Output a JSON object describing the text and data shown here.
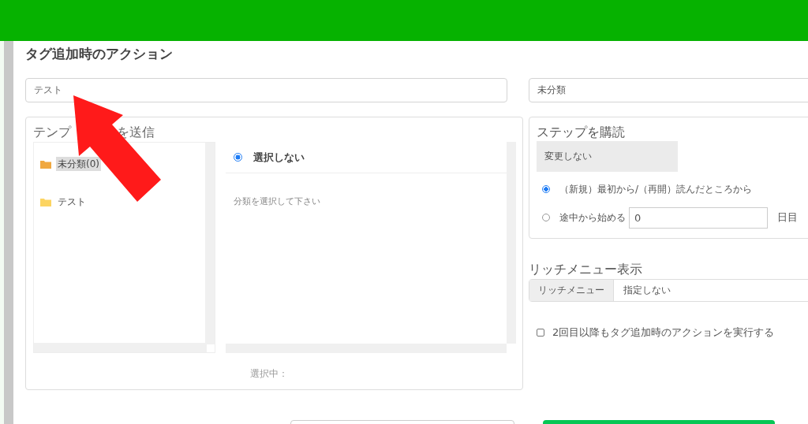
{
  "title": "タグ追加時のアクション",
  "tag_name_field": {
    "value": "テスト"
  },
  "category_select": {
    "value": "未分類"
  },
  "template_panel": {
    "heading_parts": [
      "テンプ",
      "を送信"
    ],
    "folders": [
      {
        "label": "未分類(0)",
        "selected": true
      },
      {
        "label": "テスト",
        "selected": false
      }
    ],
    "templates": [
      {
        "label": "選択しない",
        "selected": true
      }
    ],
    "hint": "分類を選択して下さい",
    "selection_label": "選択中："
  },
  "step_panel": {
    "heading": "ステップを購読",
    "current": "変更しない",
    "options": [
      {
        "kind": "radio",
        "label": "（新規）最初から/（再開）読んだところから",
        "selected": true
      },
      {
        "kind": "radio_input",
        "label": "途中から始める",
        "value": "0",
        "suffix": "日目",
        "selected": false
      }
    ]
  },
  "rich_menu": {
    "heading": "リッチメニュー表示",
    "addon": "リッチメニュー",
    "value": "指定しない"
  },
  "repeat_option": {
    "label": "2回目以降もタグ追加時のアクションを実行する",
    "checked": false
  },
  "annotation": {
    "kind": "arrow"
  }
}
